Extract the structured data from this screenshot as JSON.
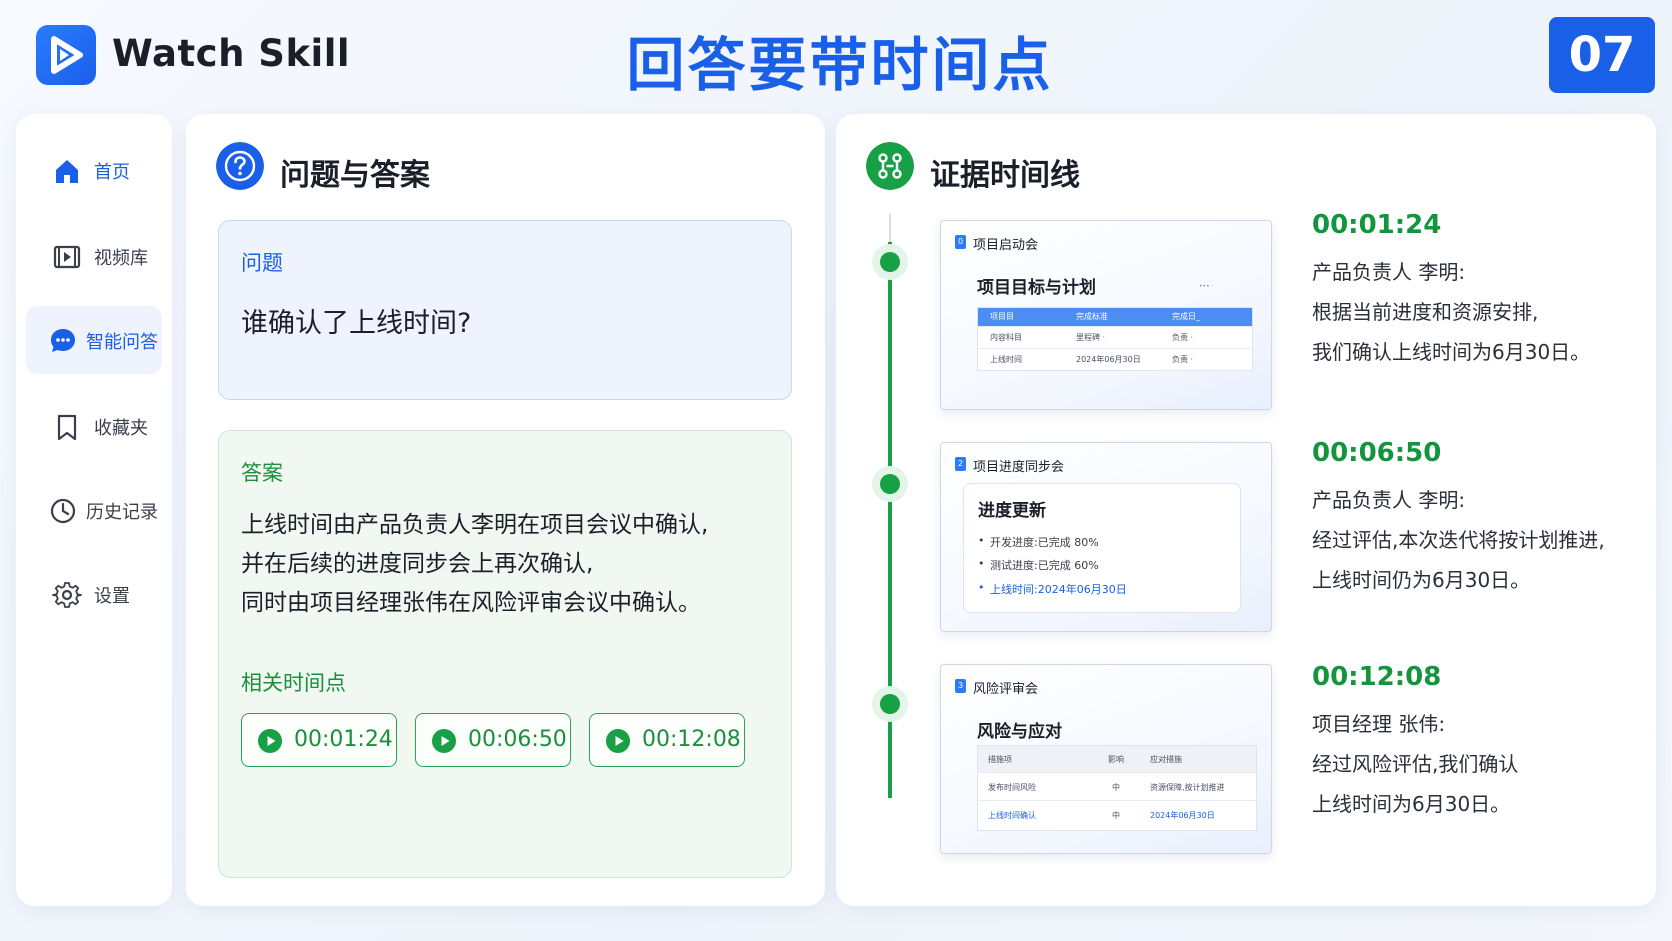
{
  "header": {
    "brand": "Watch Skill",
    "title": "回答要带时间点",
    "page_number": "07"
  },
  "sidebar": {
    "items": [
      {
        "label": "首页",
        "icon": "home-icon",
        "active": false
      },
      {
        "label": "视频库",
        "icon": "video-library-icon",
        "active": false
      },
      {
        "label": "智能问答",
        "icon": "chat-icon",
        "active": true
      },
      {
        "label": "收藏夹",
        "icon": "bookmark-icon",
        "active": false
      },
      {
        "label": "历史记录",
        "icon": "history-icon",
        "active": false
      },
      {
        "label": "设置",
        "icon": "gear-icon",
        "active": false
      }
    ]
  },
  "qa": {
    "section_title": "问题与答案",
    "question_label": "问题",
    "question_text": "谁确认了上线时间?",
    "answer_label": "答案",
    "answer_lines": [
      "上线时间由产品负责人李明在项目会议中确认,",
      "并在后续的进度同步会上再次确认,",
      "同时由项目经理张伟在风险评审会议中确认。"
    ],
    "related_label": "相关时间点",
    "timestamps": [
      "00:01:24",
      "00:06:50",
      "00:12:08"
    ]
  },
  "timeline": {
    "section_title": "证据时间线",
    "events": [
      {
        "time": "00:01:24",
        "lines": [
          "产品负责人 李明:",
          "根据当前进度和资源安排,",
          "我们确认上线时间为6月30日。"
        ],
        "thumb": {
          "tag": "0",
          "title": "项目启动会",
          "heading": "项目目标与计划",
          "note": "••• ·",
          "table_header": [
            "项目目",
            "完成标准",
            "完成日_"
          ],
          "table_rows": [
            [
              "内容科目",
              "里程碑 ·",
              "负责 ·"
            ],
            [
              "上线时间",
              "2024年06月30日",
              "负责 ·"
            ]
          ]
        }
      },
      {
        "time": "00:06:50",
        "lines": [
          "产品负责人 李明:",
          "经过评估,本次迭代将按计划推进,",
          "上线时间仍为6月30日。"
        ],
        "thumb": {
          "tag": "2",
          "title": "项目进度同步会",
          "heading": "进度更新",
          "items": [
            "开发进度:已完成 80%",
            "测试进度:已完成 60%",
            "上线时间:2024年06月30日"
          ]
        }
      },
      {
        "time": "00:12:08",
        "lines": [
          "项目经理 张伟:",
          "经过风险评估,我们确认",
          "上线时间为6月30日。"
        ],
        "thumb": {
          "tag": "3",
          "title": "风险评审会",
          "heading": "风险与应对",
          "table_header": [
            "措施项",
            "影响",
            "应对措施"
          ],
          "table_rows": [
            [
              "发布时间风险",
              "中",
              "资源保障,按计划推进"
            ],
            [
              "上线时间确认",
              "中",
              "2024年06月30日"
            ]
          ]
        }
      }
    ]
  },
  "colors": {
    "primary_blue": "#1a5fe8",
    "success_green": "#18a046",
    "question_bg": "#eef3fd",
    "answer_bg": "#f0f8f1"
  }
}
